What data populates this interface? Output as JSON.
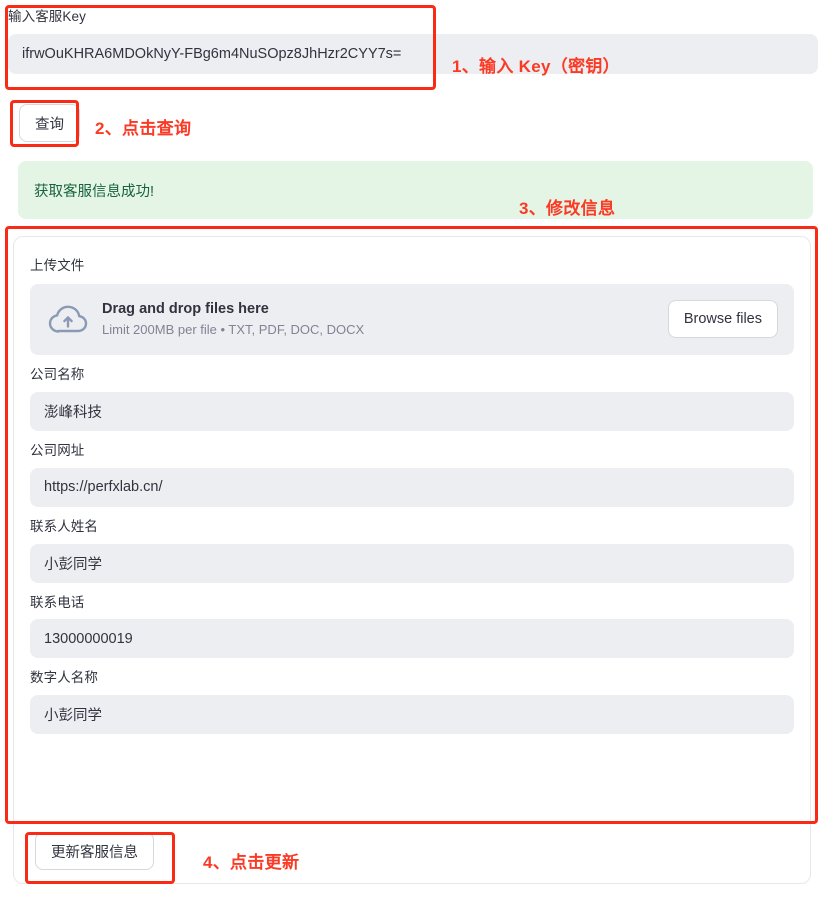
{
  "key_section": {
    "label": "输入客服Key",
    "value": "ifrwOuKHRA6MDOkNyY-FBg6m4NuSOpz8JhHzr2CYY7s=",
    "placeholder": ""
  },
  "query_button": {
    "label": "查询"
  },
  "status": {
    "message": "获取客服信息成功!"
  },
  "uploader": {
    "label": "上传文件",
    "title": "Drag and drop files here",
    "subtitle": "Limit 200MB per file • TXT, PDF, DOC, DOCX",
    "browse_label": "Browse files",
    "icon": "cloud-upload-icon"
  },
  "fields": [
    {
      "label": "公司名称",
      "value": "澎峰科技"
    },
    {
      "label": "公司网址",
      "value": "https://perfxlab.cn/"
    },
    {
      "label": "联系人姓名",
      "value": "小彭同学"
    },
    {
      "label": "联系电话",
      "value": "13000000019"
    },
    {
      "label": "数字人名称",
      "value": "小彭同学"
    }
  ],
  "update_button": {
    "label": "更新客服信息"
  },
  "annotations": [
    {
      "id": "step-1",
      "text": "1、输入 Key（密钥）"
    },
    {
      "id": "step-2",
      "text": "2、点击查询"
    },
    {
      "id": "step-3",
      "text": "3、修改信息"
    },
    {
      "id": "step-4",
      "text": "4、点击更新"
    }
  ],
  "colors": {
    "annotation_red": "#fb3a25",
    "success_bg": "#e4f5e6",
    "success_text": "#17633c",
    "input_bg": "#eceef1",
    "icon_slate": "#8a9ab5"
  }
}
